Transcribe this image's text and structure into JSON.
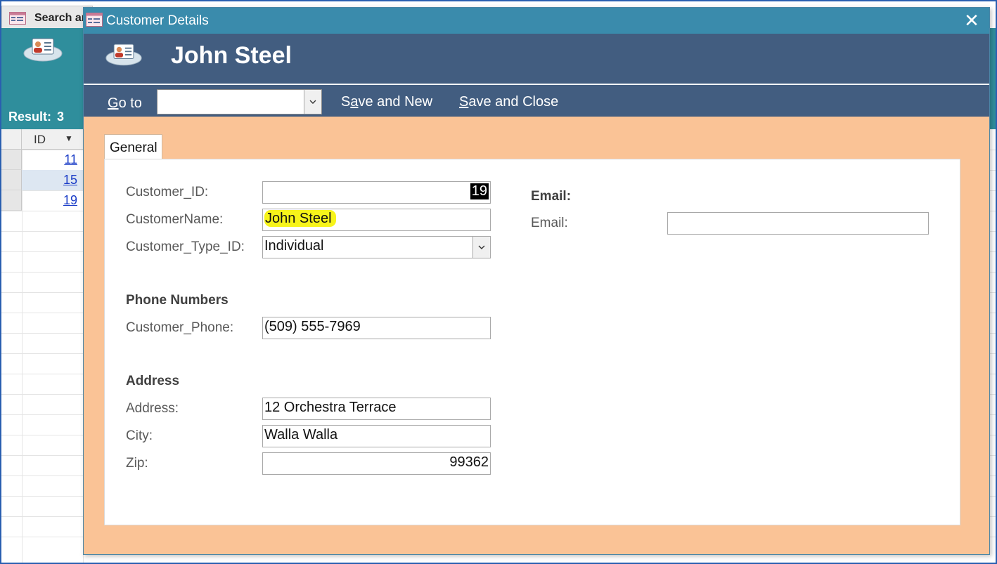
{
  "background_window": {
    "title": "Search ar",
    "result_label": "Result:",
    "result_count": "3",
    "grid": {
      "column_header": "ID",
      "rows": [
        {
          "id": "11"
        },
        {
          "id": "15"
        },
        {
          "id": "19"
        }
      ]
    }
  },
  "dialog": {
    "title": "Customer Details",
    "header_title": "John Steel",
    "toolbar": {
      "goto_label": "Go to",
      "goto_value": "",
      "save_new_label": "Save and New",
      "save_close_label": "Save and Close"
    },
    "tabs": [
      {
        "label": "General",
        "selected": true
      }
    ],
    "form": {
      "customer_id_label": "Customer_ID:",
      "customer_id_value": "19",
      "customer_name_label": "CustomerName:",
      "customer_name_value": "John Steel",
      "customer_type_label": "Customer_Type_ID:",
      "customer_type_value": "Individual",
      "phone_section": "Phone Numbers",
      "customer_phone_label": "Customer_Phone:",
      "customer_phone_value": "(509) 555-7969",
      "address_section": "Address",
      "address_label": "Address:",
      "address_value": "12 Orchestra Terrace",
      "city_label": "City:",
      "city_value": "Walla Walla",
      "zip_label": "Zip:",
      "zip_value": "99362",
      "email_section": "Email:",
      "email_label": "Email:",
      "email_value": ""
    }
  },
  "colors": {
    "dialog_titlebar": "#3a8bac",
    "dialog_header": "#425d80",
    "dialog_body": "#fac396",
    "background_header": "#2f8e9c",
    "highlight": "#f7f41a"
  }
}
